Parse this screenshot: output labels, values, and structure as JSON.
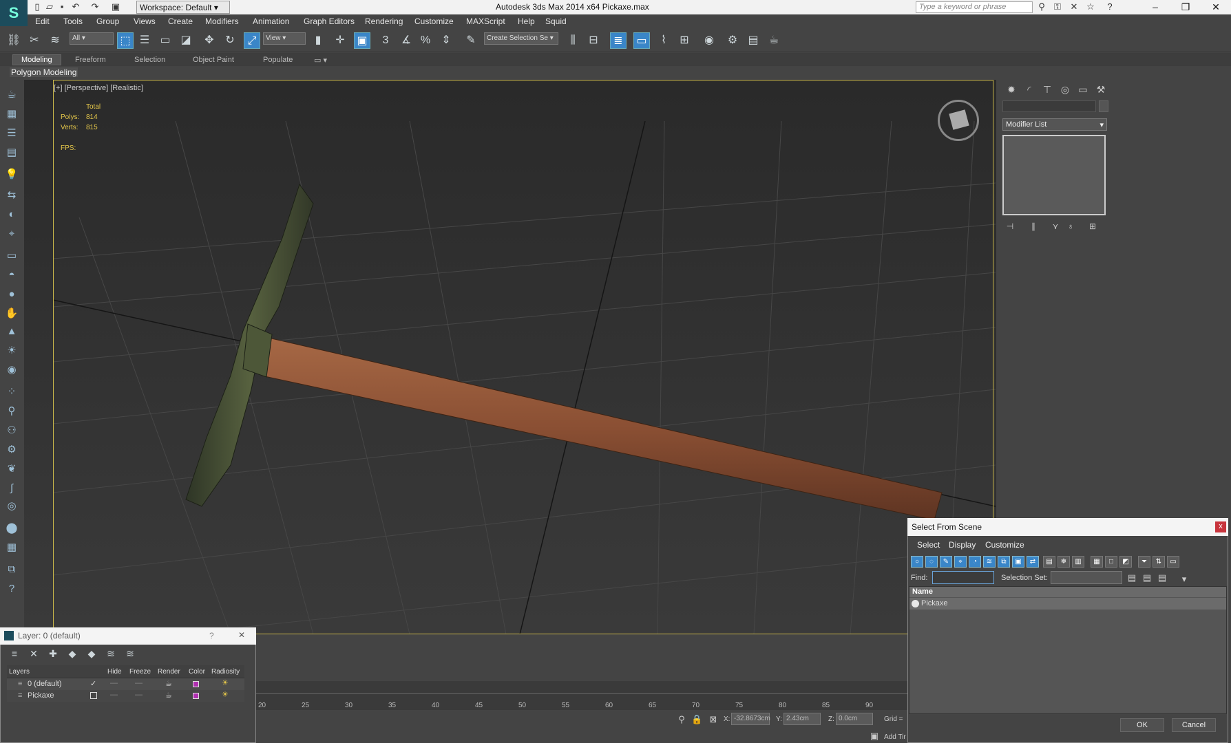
{
  "titlebar": {
    "title": "Autodesk 3ds Max  2014 x64    Pickaxe.max",
    "workspace": "Workspace: Default",
    "search_placeholder": "Type a keyword or phrase",
    "minimize": "–",
    "maximize": "❐",
    "close": "✕"
  },
  "menubar": [
    "Edit",
    "Tools",
    "Group",
    "Views",
    "Create",
    "Modifiers",
    "Animation",
    "Graph Editors",
    "Rendering",
    "Customize",
    "MAXScript",
    "Help",
    "Squid"
  ],
  "toolbar": {
    "selection_filter": "All",
    "ref_coord": "View",
    "snap_3": "3",
    "named_selection_placeholder": "Create Selection Se"
  },
  "ribbon": {
    "tabs": [
      "Modeling",
      "Freeform",
      "Selection",
      "Object Paint",
      "Populate"
    ],
    "active_tab": "Modeling",
    "sub_label": "Polygon Modeling"
  },
  "viewport": {
    "label": "[+] [Perspective] [Realistic]",
    "stats": {
      "header": "Total",
      "polys_label": "Polys:",
      "polys": "814",
      "verts_label": "Verts:",
      "verts": "815",
      "fps_label": "FPS:"
    }
  },
  "command_panel": {
    "modifier_list": "Modifier List"
  },
  "select_from_scene": {
    "title": "Select From Scene",
    "close": "x",
    "menus": [
      "Select",
      "Display",
      "Customize"
    ],
    "find_label": "Find:",
    "selection_set_label": "Selection Set:",
    "column_name": "Name",
    "rows": [
      "Pickaxe"
    ],
    "ok": "OK",
    "cancel": "Cancel"
  },
  "layer_dialog": {
    "title": "Layer: 0 (default)",
    "help": "?",
    "close": "✕",
    "columns": [
      "Layers",
      "Hide",
      "Freeze",
      "Render",
      "Color",
      "Radiosity"
    ],
    "rows": [
      {
        "name": "0 (default)",
        "current": "✓"
      },
      {
        "name": "Pickaxe",
        "current": ""
      }
    ],
    "colors": {
      "layer_swatch": "#b02fb0"
    }
  },
  "timeline": {
    "ticks": [
      "20",
      "25",
      "30",
      "35",
      "40",
      "45",
      "50",
      "55",
      "60",
      "65",
      "70",
      "75",
      "80",
      "85",
      "90"
    ]
  },
  "status": {
    "x_label": "X:",
    "x_value": "-32.8673cm",
    "y_label": "Y:",
    "y_value": "2.43cm",
    "z_label": "Z:",
    "z_value": "0.0cm",
    "grid_label": "Grid =",
    "add_time_tag": "Add Tir"
  },
  "colors": {
    "viewport_frame": "#c9b74a",
    "accent_blue": "#3a86c8",
    "stats_text": "#e6c84a"
  }
}
